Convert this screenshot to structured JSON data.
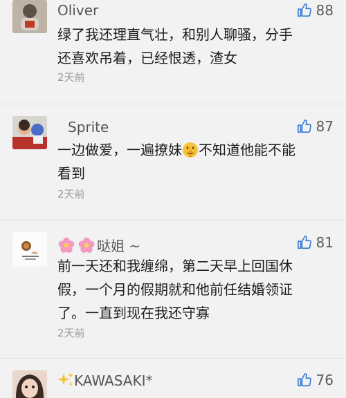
{
  "comments": [
    {
      "username": "Oliver",
      "likes": "88",
      "text_line1": "绿了我还理直气壮，和别人聊骚，分手",
      "text_line2": "还喜欢吊着，已经恨透，渣女",
      "time": "2天前"
    },
    {
      "username": "Sprite",
      "likes": "87",
      "text_before_emoji": "一边做爱，一遍撩妹",
      "text_after_emoji": "不知道他能不能",
      "text_line2": "看到",
      "time": "2天前"
    },
    {
      "username": "哒姐 ~",
      "likes": "81",
      "text_line1": "前一天还和我缠绵，第二天早上回国休",
      "text_line2": "假，一个月的假期就和他前任结婚领证",
      "text_line3": "了。一直到现在我还守寡",
      "time": "2天前"
    },
    {
      "username": "KAWASAKI*",
      "likes": "76"
    }
  ],
  "icons": {
    "like": "thumbs-up-icon",
    "flower": "cherry-blossom-icon",
    "sparkles": "sparkles-icon",
    "shush": "shushing-face-icon"
  },
  "colors": {
    "like_icon": "#3a7bd5",
    "background": "#f2f2f2"
  }
}
